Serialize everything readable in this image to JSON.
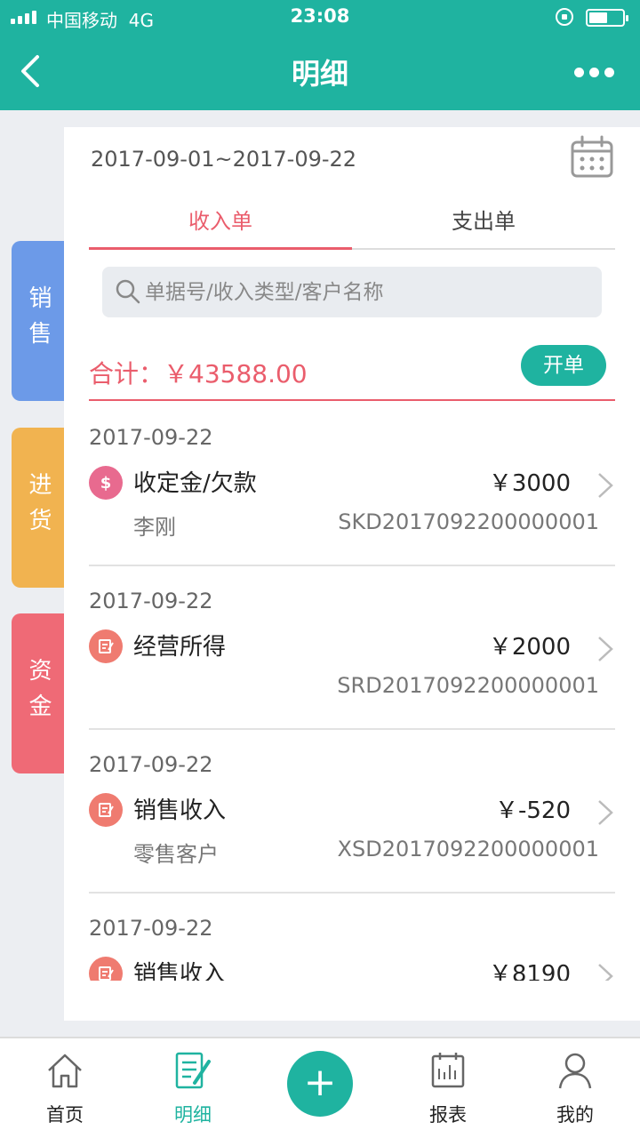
{
  "status_bar": {
    "carrier": "中国移动",
    "network": "4G",
    "time": "23:08"
  },
  "header": {
    "title": "明细",
    "back_icon": "back-chevron-icon",
    "more_icon": "more-dots-icon"
  },
  "side_tabs": [
    {
      "label": "销售",
      "color": "#6c9ae8"
    },
    {
      "label": "进货",
      "color": "#f1b350"
    },
    {
      "label": "资金",
      "color": "#ef6a76",
      "active": true
    }
  ],
  "filter": {
    "date_range": "2017-09-01~2017-09-22"
  },
  "tabs": [
    {
      "label": "收入单",
      "active": true
    },
    {
      "label": "支出单",
      "active": false
    }
  ],
  "search": {
    "placeholder": "单据号/收入类型/客户名称",
    "value": ""
  },
  "summary": {
    "total_label": "合计：￥43588.00",
    "open_button": "开单"
  },
  "records": [
    {
      "date": "2017-09-22",
      "icon": "dollar-icon",
      "type": "收定金/欠款",
      "amount": "￥3000",
      "customer": "李刚",
      "number": "SKD2017092200000001"
    },
    {
      "date": "2017-09-22",
      "icon": "note-icon",
      "type": "经营所得",
      "amount": "￥2000",
      "customer": "",
      "number": "SRD2017092200000001"
    },
    {
      "date": "2017-09-22",
      "icon": "note-icon",
      "type": "销售收入",
      "amount": "￥-520",
      "customer": "零售客户",
      "number": "XSD2017092200000001"
    },
    {
      "date": "2017-09-22",
      "icon": "note-icon",
      "type": "销售收入",
      "amount": "￥8190",
      "customer": "",
      "number": ""
    }
  ],
  "bottom_nav": {
    "home": "首页",
    "detail": "明细",
    "add": "+",
    "report": "报表",
    "mine": "我的"
  },
  "colors": {
    "brand": "#1fb3a0",
    "accent_red": "#ea5d6c"
  }
}
